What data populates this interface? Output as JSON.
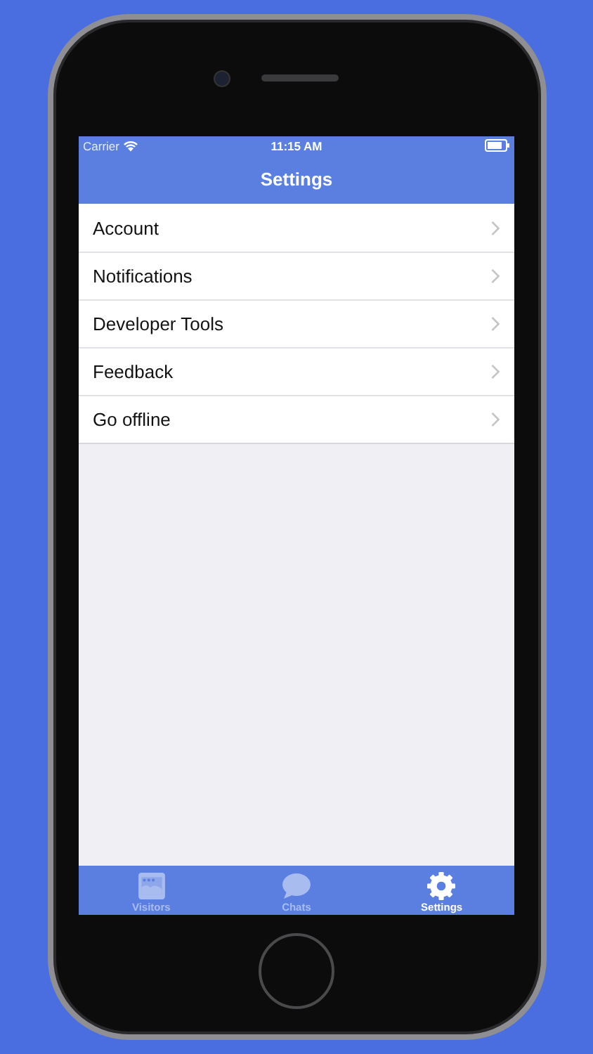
{
  "status_bar": {
    "carrier": "Carrier",
    "time": "11:15 AM"
  },
  "nav_bar": {
    "title": "Settings"
  },
  "menu_items": [
    {
      "label": "Account"
    },
    {
      "label": "Notifications"
    },
    {
      "label": "Developer Tools"
    },
    {
      "label": "Feedback"
    },
    {
      "label": "Go offline"
    }
  ],
  "tab_bar": [
    {
      "label": "Visitors",
      "selected": false
    },
    {
      "label": "Chats",
      "selected": false
    },
    {
      "label": "Settings",
      "selected": true
    }
  ]
}
